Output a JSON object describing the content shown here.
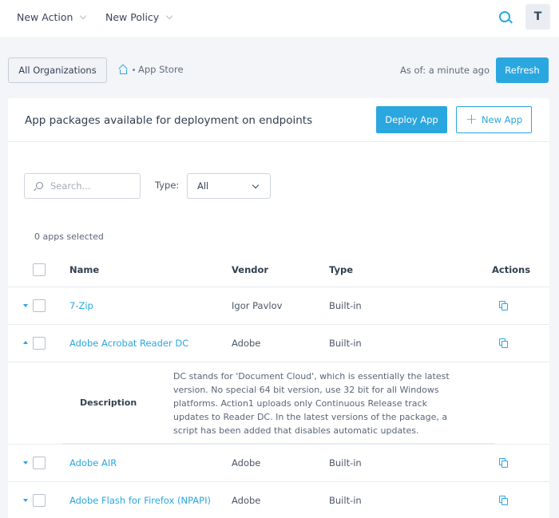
{
  "topbar": {
    "menus": [
      {
        "label": "New Action"
      },
      {
        "label": "New Policy"
      }
    ],
    "avatar_initial": "T"
  },
  "breadcrumb": {
    "org_button": "All Organizations",
    "current": "App Store",
    "as_of": "As of: a minute ago",
    "refresh": "Refresh"
  },
  "card": {
    "title": "App packages available for deployment on endpoints",
    "deploy_button": "Deploy App",
    "new_app_button": "New App",
    "search_placeholder": "Search...",
    "type_label": "Type:",
    "type_value": "All",
    "selected_count": "0 apps selected"
  },
  "table": {
    "columns": {
      "name": "Name",
      "vendor": "Vendor",
      "type": "Type",
      "actions": "Actions"
    },
    "rows": [
      {
        "name": "7-Zip",
        "vendor": "Igor Pavlov",
        "type": "Built-in",
        "expanded": false
      },
      {
        "name": "Adobe Acrobat Reader DC",
        "vendor": "Adobe",
        "type": "Built-in",
        "expanded": true
      },
      {
        "name": "Adobe AIR",
        "vendor": "Adobe",
        "type": "Built-in",
        "expanded": false
      },
      {
        "name": "Adobe Flash for Firefox (NPAPI)",
        "vendor": "Adobe",
        "type": "Built-in",
        "expanded": false
      }
    ],
    "description": {
      "label": "Description",
      "text": "DC stands for 'Document Cloud', which is essentially the latest version. No special 64 bit version, use 32 bit for all Windows platforms. Action1 uploads only Continuous Release track updates to Reader DC. In the latest versions of the package, a script has been added that disables automatic updates."
    }
  },
  "colors": {
    "accent": "#2ba7e0",
    "background": "#f4f5f8"
  }
}
